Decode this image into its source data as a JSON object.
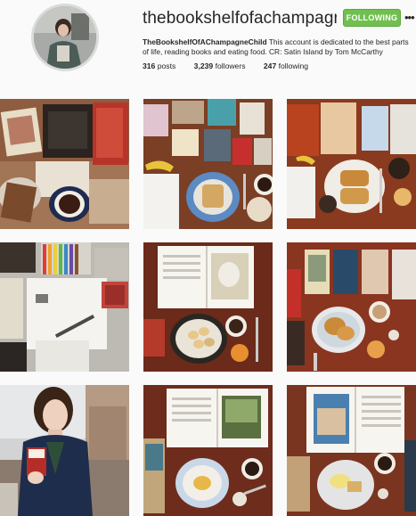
{
  "profile": {
    "username": "thebookshelfofachampagnechild",
    "follow_label": "FOLLOWING",
    "more_icon": "ellipsis-icon",
    "display_name": "TheBookshelfOfAChampagneChild",
    "bio_text": " This account is dedicated to the best parts of life, reading books and eating food. CR: Satin Island by Tom McCarthy"
  },
  "stats": {
    "posts_count": "316",
    "posts_label": "posts",
    "followers_count": "3,239",
    "followers_label": "followers",
    "following_count": "247",
    "following_label": "following"
  },
  "colors": {
    "follow_button": "#70c050",
    "background": "#fafafa"
  },
  "posts": [
    {
      "id": "post-1",
      "subject": "postcards, tea cup and tart"
    },
    {
      "id": "post-2",
      "subject": "books, toast and coffee flat lay"
    },
    {
      "id": "post-3",
      "subject": "books, french toast and ice cream"
    },
    {
      "id": "post-4",
      "subject": "colored pencils, notebook and pen"
    },
    {
      "id": "post-5",
      "subject": "open book and dumplings"
    },
    {
      "id": "post-6",
      "subject": "books, waffles and coffee"
    },
    {
      "id": "post-7",
      "subject": "person in navy coat holding book"
    },
    {
      "id": "post-8",
      "subject": "open book, porridge and coffee"
    },
    {
      "id": "post-9",
      "subject": "open book, eggs and toast"
    }
  ]
}
